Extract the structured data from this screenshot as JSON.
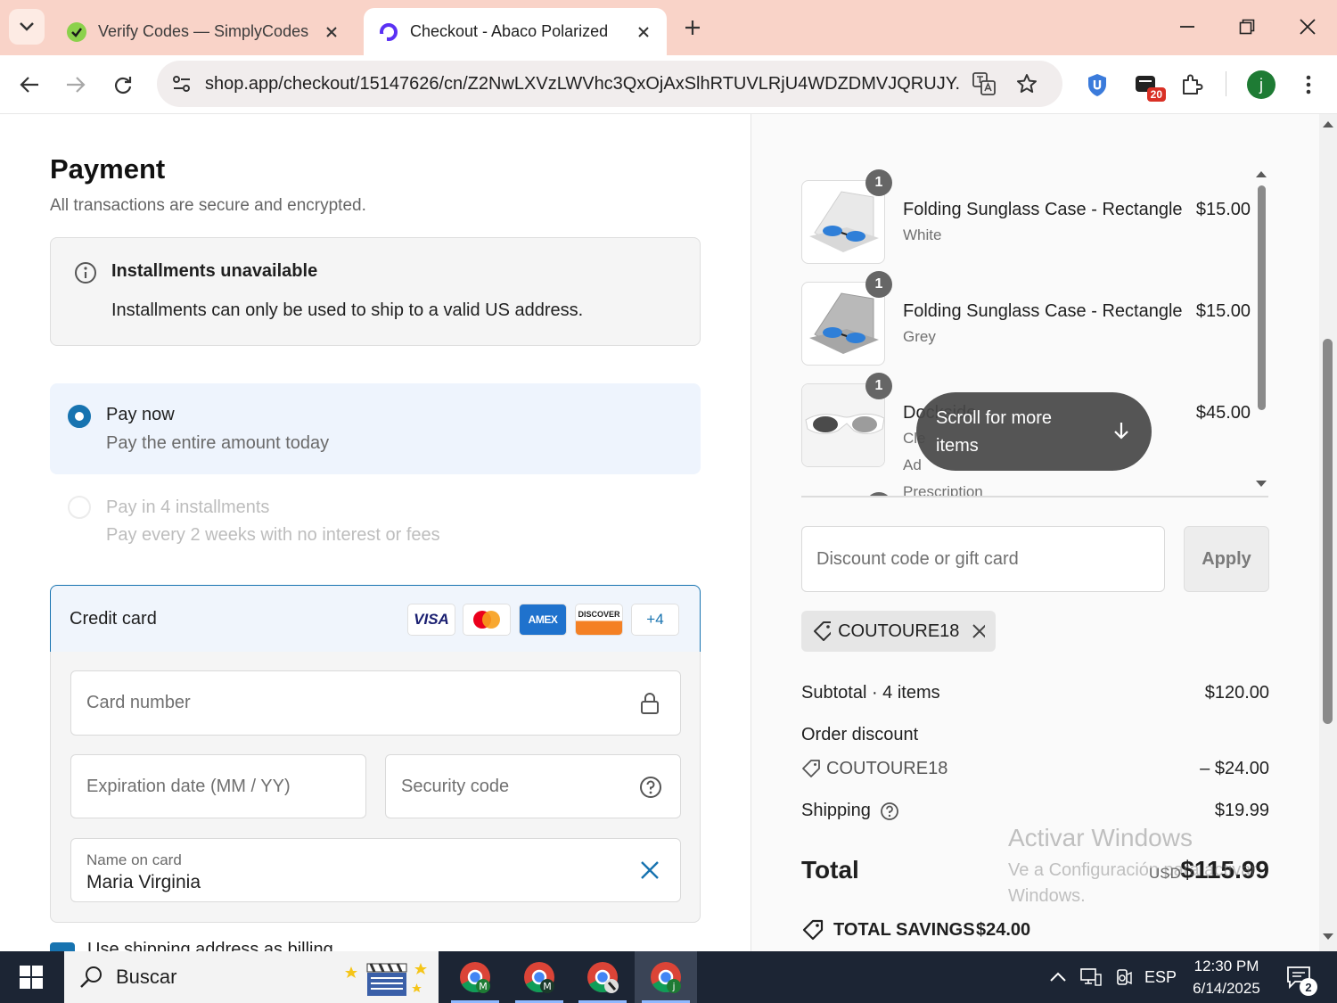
{
  "browser": {
    "tabs": [
      {
        "title": "Verify Codes — SimplyCodes",
        "active": false,
        "favicon": "simplycodes-icon"
      },
      {
        "title": "Checkout - Abaco Polarized",
        "active": true,
        "favicon": "shop-icon"
      }
    ],
    "url": "shop.app/checkout/15147626/cn/Z2NwLXVzLWVhc3QxOjAxSlhRTUVLRjU4WDZDMVJQRUJY...",
    "extension_badge": "20",
    "profile_initial": "j"
  },
  "payment": {
    "title": "Payment",
    "subtitle": "All transactions are secure and encrypted.",
    "installments_notice": {
      "title": "Installments unavailable",
      "body": "Installments can only be used to ship to a valid US address."
    },
    "options": [
      {
        "label": "Pay now",
        "description": "Pay the entire amount today",
        "selected": true
      },
      {
        "label": "Pay in 4 installments",
        "description": "Pay every 2 weeks with no interest or fees",
        "selected": false,
        "disabled": true
      }
    ],
    "credit_card": {
      "label": "Credit card",
      "logos": [
        "VISA",
        "Mastercard",
        "AMEX",
        "DISCOVER"
      ],
      "more": "+4",
      "card_number_placeholder": "Card number",
      "expiry_placeholder": "Expiration date (MM / YY)",
      "cvv_placeholder": "Security code",
      "name_label": "Name on card",
      "name_value": "Maria Virginia"
    },
    "billing_checkbox_label": "Use shipping address as billing address"
  },
  "summary": {
    "items": [
      {
        "qty": "1",
        "name": "Folding Sunglass Case - Rectangle",
        "variant": "White",
        "price": "$15.00"
      },
      {
        "qty": "1",
        "name": "Folding Sunglass Case - Rectangle",
        "variant": "Grey",
        "price": "$15.00"
      },
      {
        "qty": "1",
        "name": "Dockside",
        "variant_lines": [
          "Cle",
          "Ad",
          "Prescription"
        ],
        "price": "$45.00"
      }
    ],
    "scroll_hint": "Scroll for more items",
    "discount_placeholder": "Discount code or gift card",
    "apply_label": "Apply",
    "applied_code": "COUTOURE18",
    "subtotal_label": "Subtotal · 4 items",
    "subtotal_value": "$120.00",
    "order_discount_label": "Order discount",
    "discount_code": "COUTOURE18",
    "discount_value": "– $24.00",
    "shipping_label": "Shipping",
    "shipping_value": "$19.99",
    "total_label": "Total",
    "total_currency": "USD",
    "total_value": "$115.99",
    "savings_label": "TOTAL SAVINGS",
    "savings_value": "$24.00"
  },
  "watermark": {
    "title": "Activar Windows",
    "body": "Ve a Configuración para activar Windows."
  },
  "taskbar": {
    "search_text": "Buscar",
    "apps": [
      {
        "name": "chrome-profile-m",
        "badge": "M"
      },
      {
        "name": "chrome-profile-m2",
        "badge": "M"
      },
      {
        "name": "chrome-profile-3",
        "badge": ""
      },
      {
        "name": "chrome-profile-j",
        "badge": "j"
      }
    ],
    "language": "ESP",
    "time": "12:30 PM",
    "date": "6/14/2025",
    "notifications": "2"
  },
  "colors": {
    "accent": "#1773b0",
    "tabstrip": "#f9d3c8",
    "taskbar": "#1c2534"
  }
}
